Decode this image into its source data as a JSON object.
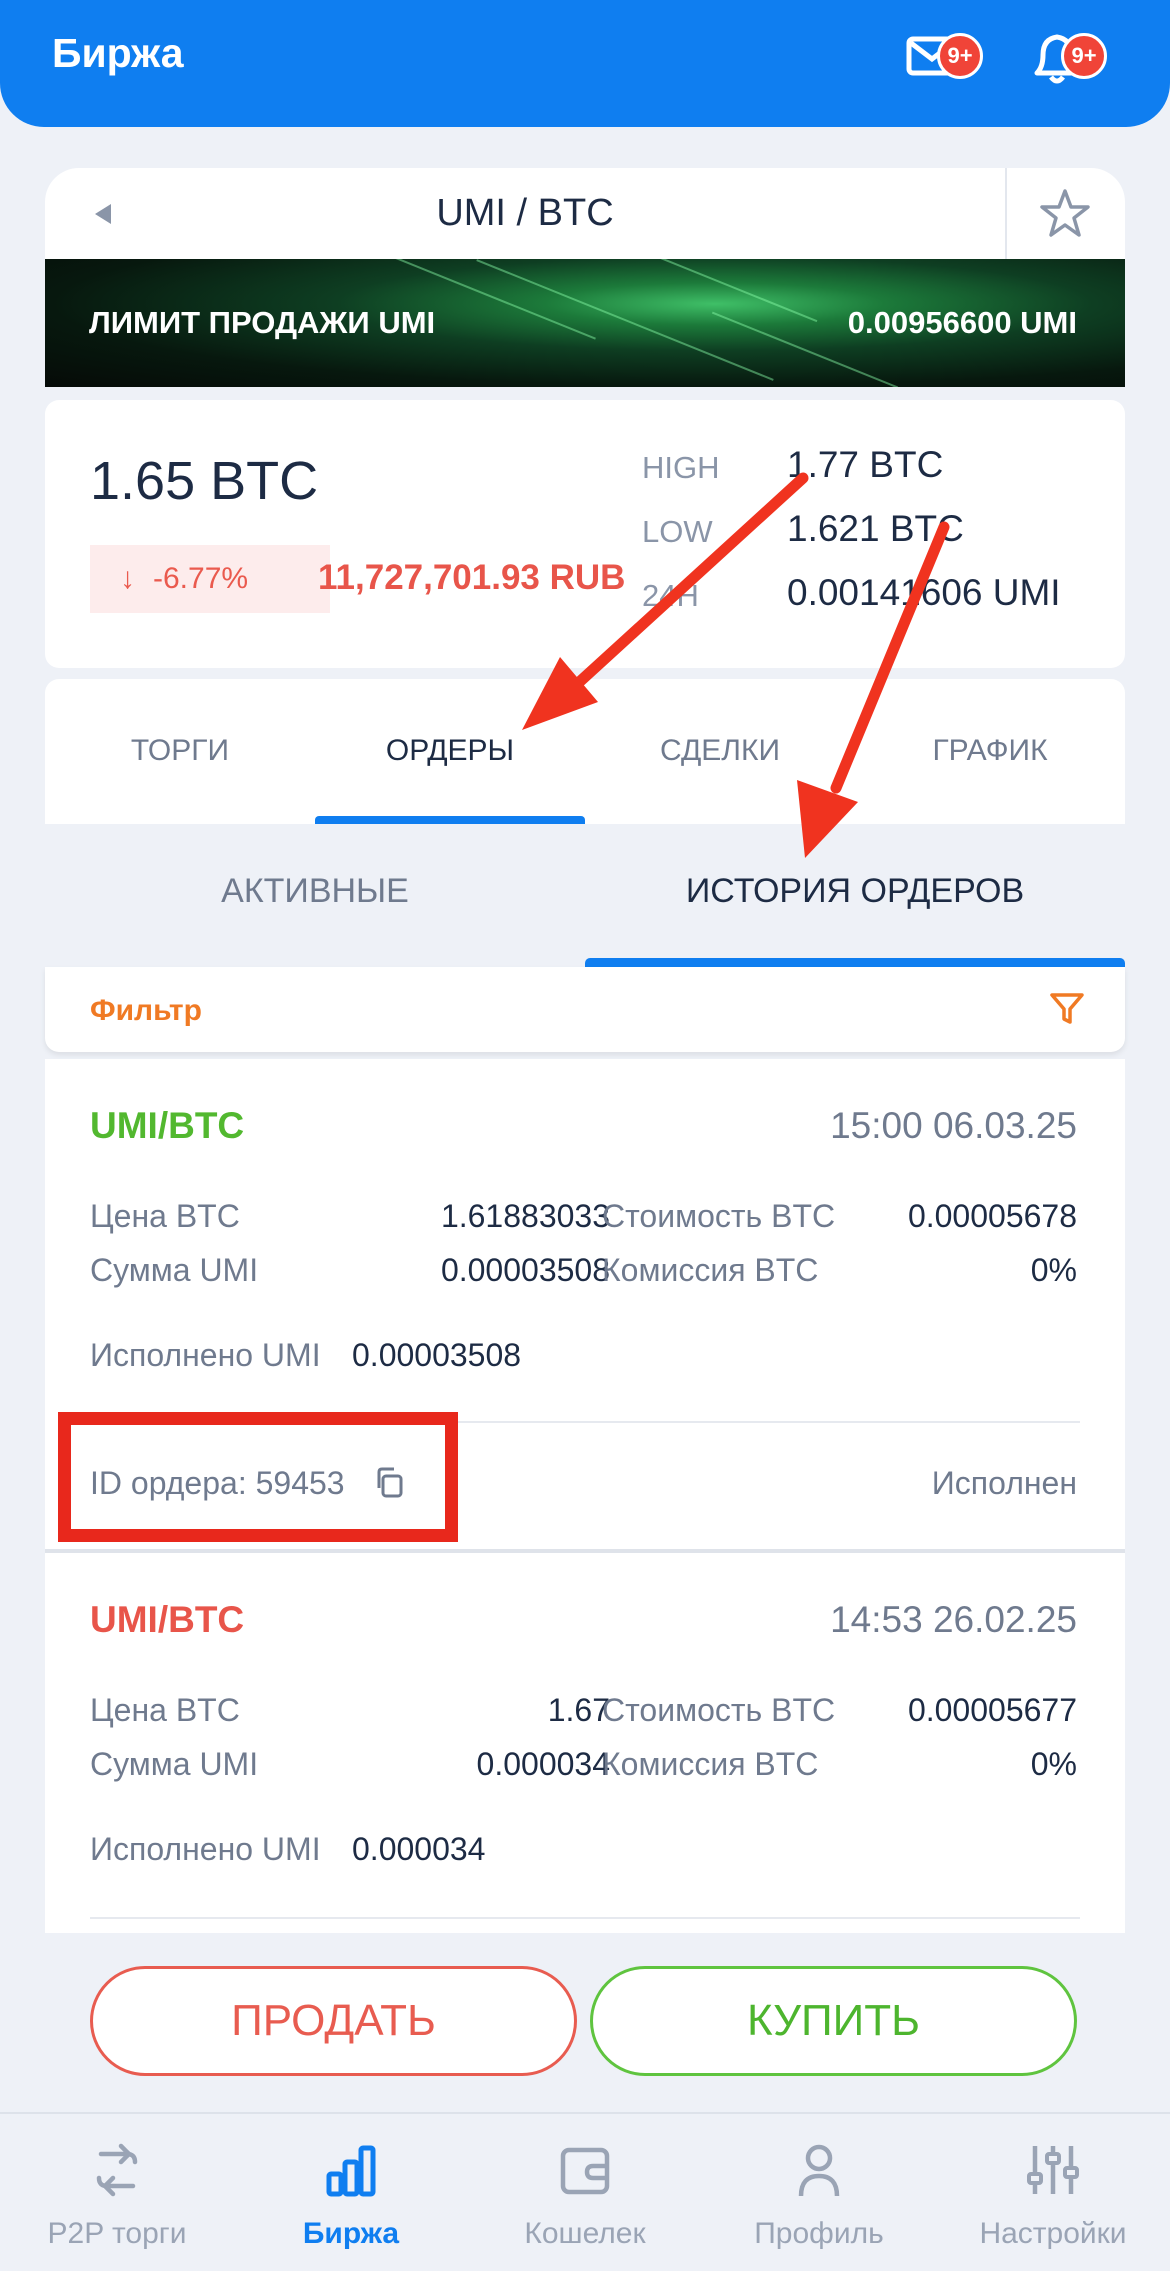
{
  "header": {
    "title": "Биржа",
    "mail_badge": "9+",
    "bell_badge": "9+"
  },
  "pair": {
    "title": "UMI / BTC"
  },
  "banner": {
    "left": "ЛИМИТ ПРОДАЖИ UMI",
    "right": "0.00956600 UMI"
  },
  "stats": {
    "price": "1.65 BTC",
    "change": "-6.77%",
    "rub": "11,727,701.93 RUB",
    "high_label": "HIGH",
    "high_value": "1.77 BTC",
    "low_label": "LOW",
    "low_value": "1.621 BTC",
    "h24_label": "24H",
    "h24_value": "0.00141606 UMI"
  },
  "tabs": [
    "ТОРГИ",
    "ОРДЕРЫ",
    "СДЕЛКИ",
    "ГРАФИК"
  ],
  "subtabs": {
    "active_orders": "АКТИВНЫЕ",
    "history": "ИСТОРИЯ ОРДЕРОВ"
  },
  "filter": {
    "label": "Фильтр"
  },
  "orders": [
    {
      "pair": "UMI/BTC",
      "pair_color": "#52b82f",
      "time": "15:00 06.03.25",
      "price_label": "Цена BTC",
      "price": "1.61883033",
      "cost_label": "Стоимость BTC",
      "cost": "0.00005678",
      "amount_label": "Сумма UMI",
      "amount": "0.00003508",
      "fee_label": "Комиссия BTC",
      "fee": "0%",
      "filled_label": "Исполнено UMI",
      "filled": "0.00003508",
      "id_text": "ID ордера: 59453",
      "status": "Исполнен"
    },
    {
      "pair": "UMI/BTC",
      "pair_color": "#e8554a",
      "time": "14:53 26.02.25",
      "price_label": "Цена BTC",
      "price": "1.67",
      "cost_label": "Стоимость BTC",
      "cost": "0.00005677",
      "amount_label": "Сумма UMI",
      "amount": "0.000034",
      "fee_label": "Комиссия BTC",
      "fee": "0%",
      "filled_label": "Исполнено UMI",
      "filled": "0.000034"
    }
  ],
  "actions": {
    "sell": "ПРОДАТЬ",
    "buy": "КУПИТЬ"
  },
  "nav": [
    {
      "label": "P2P торги",
      "icon": "p2p-arrows-icon"
    },
    {
      "label": "Биржа",
      "icon": "bar-chart-icon"
    },
    {
      "label": "Кошелек",
      "icon": "wallet-icon"
    },
    {
      "label": "Профиль",
      "icon": "profile-icon"
    },
    {
      "label": "Настройки",
      "icon": "sliders-icon"
    }
  ],
  "colors": {
    "accent": "#0f7ef0",
    "sell": "#e85c50",
    "buy": "#5fc43f",
    "filter": "#f07a24"
  }
}
